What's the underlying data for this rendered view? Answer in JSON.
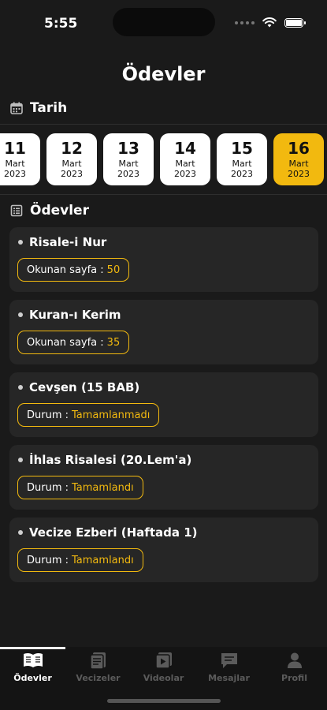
{
  "status_bar": {
    "time": "5:55"
  },
  "page": {
    "title": "Ödevler"
  },
  "date_section": {
    "title": "Tarih"
  },
  "dates": [
    {
      "day": "11",
      "month": "Mart",
      "year": "2023",
      "selected": false
    },
    {
      "day": "12",
      "month": "Mart",
      "year": "2023",
      "selected": false
    },
    {
      "day": "13",
      "month": "Mart",
      "year": "2023",
      "selected": false
    },
    {
      "day": "14",
      "month": "Mart",
      "year": "2023",
      "selected": false
    },
    {
      "day": "15",
      "month": "Mart",
      "year": "2023",
      "selected": false
    },
    {
      "day": "16",
      "month": "Mart",
      "year": "2023",
      "selected": true
    }
  ],
  "tasks_section": {
    "title": "Ödevler"
  },
  "tasks": [
    {
      "title": "Risale-i Nur",
      "label": "Okunan sayfa :",
      "value": "50"
    },
    {
      "title": "Kuran-ı Kerim",
      "label": "Okunan sayfa :",
      "value": "35"
    },
    {
      "title": "Cevşen (15 BAB)",
      "label": "Durum :",
      "value": "Tamamlanmadı"
    },
    {
      "title": "İhlas Risalesi (20.Lem'a)",
      "label": "Durum :",
      "value": "Tamamlandı"
    },
    {
      "title": "Vecize Ezberi (Haftada 1)",
      "label": "Durum :",
      "value": "Tamamlandı"
    }
  ],
  "tab_bar": {
    "tabs": [
      {
        "label": "Ödevler",
        "icon": "book-open-icon",
        "active": true
      },
      {
        "label": "Vecizeler",
        "icon": "notes-icon",
        "active": false
      },
      {
        "label": "Videolar",
        "icon": "video-icon",
        "active": false
      },
      {
        "label": "Mesajlar",
        "icon": "chat-icon",
        "active": false
      },
      {
        "label": "Profil",
        "icon": "user-icon",
        "active": false
      }
    ]
  },
  "colors": {
    "accent": "#f2b90f",
    "background": "#1a1a1a",
    "card": "#262626"
  }
}
